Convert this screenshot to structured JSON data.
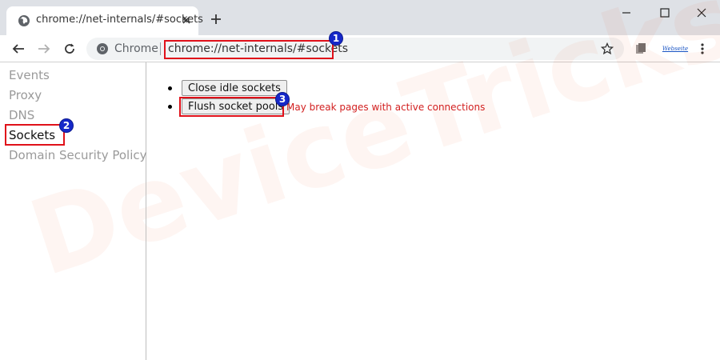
{
  "tab": {
    "title": "chrome://net-internals/#sockets"
  },
  "omnibox": {
    "chip": "Chrome",
    "url": "chrome://net-internals/#sockets"
  },
  "sidebar": {
    "items": [
      {
        "label": "Events"
      },
      {
        "label": "Proxy"
      },
      {
        "label": "DNS"
      },
      {
        "label": "Sockets"
      },
      {
        "label": "Domain Security Policy"
      }
    ]
  },
  "main": {
    "close_idle_label": "Close idle sockets",
    "flush_pools_label": "Flush socket pools",
    "warning": "May break pages with active connections"
  },
  "annotations": {
    "badge1": "1",
    "badge2": "2",
    "badge3": "3"
  },
  "watermark": "DeviceTricks",
  "colors": {
    "highlight": "#e0111a",
    "badge": "#1628c9",
    "warning": "#d21f1f",
    "tabstrip": "#dee1e6"
  }
}
